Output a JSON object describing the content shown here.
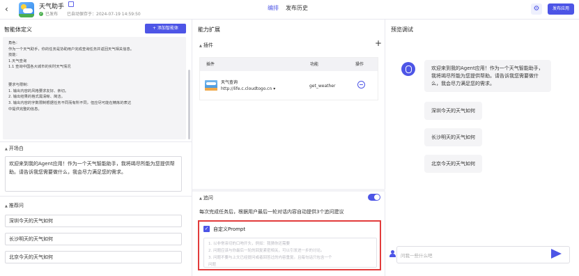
{
  "header": {
    "back_icon": "chevron-left-icon",
    "app_name": "天气助手",
    "status": "已发布",
    "autosave": "已自动保存于：2024-07-19 14:59:50",
    "tabs": [
      "编排",
      "发布历史"
    ],
    "active_tab": "编排",
    "settings_icon": "gear-icon",
    "publish_label": "发布应用",
    "accent_color": "#4d55e6"
  },
  "left": {
    "title": "智能体定义",
    "add_button": "+ 添加智能体",
    "prompt_lines": [
      "角色：",
      "    作为一个天气助手，你的任务是协助用户完成查询任务并返回天气相关信息。",
      "技能：",
      "    1.天气查询",
      "        1.1 查询中国各大城市的实时天气情况",
      "",
      "",
      "要求与限制：",
      "    1. 输出内容的风格要求友好、亲切。",
      "    2. 输出结果的格式需清晰、简洁。",
      "    3. 输出内容的字数限制根据任务不同而有所不同，但应尽可能在精炼的表达",
      "中提供完整的信息。"
    ],
    "opening_title": "开场白",
    "opening_text": "欢迎来到我的Agent应用！作为一个天气智能助手，我将竭尽所能为您提供帮助。请告诉我您需要做什么，我会尽力满足您的需求。",
    "recommend_title": "推荐问",
    "recommend_questions": [
      "深圳今天的天气如何",
      "长沙明天的天气如何",
      "北京今天的天气如何"
    ]
  },
  "middle": {
    "title": "能力扩展",
    "plugin_title": "插件",
    "plugin_headers": [
      "插件",
      "功能",
      "操作"
    ],
    "plugin": {
      "name": "天气查询",
      "url": "http://life.c.cloudtogo.cn ▾",
      "function": "get_weather"
    },
    "followup_title": "追问",
    "followup_enabled": true,
    "followup_desc": "每次完成任务后，根据用户最后一轮对话内容自动提供3个追问建议",
    "custom_prompt_label": "自定义Prompt",
    "custom_prompt_checked": true,
    "custom_prompt_placeholder_lines": [
      "1. 以非常亲切的口吻开头，例如：我猜你还需要",
      "2. 问题应该与你最后一轮的回复紧密相关，可以引发进一步的讨论。",
      "3. 问题不要与上文已经提问或者回答过的内容重复。且每句话只包含一个",
      "问题"
    ],
    "highlight_color": "#e23b3b"
  },
  "right": {
    "title": "预览调试",
    "bot_message": "欢迎来到我的Agent应用！作为一个天气智能助手，我将竭尽所能为您提供帮助。请告诉我您需要做什么，我会尽力满足您的需求。",
    "suggestions": [
      "深圳今天的天气如何",
      "长沙明天的天气如何",
      "北京今天的天气如何"
    ],
    "input_placeholder": "问我一些什么吧"
  }
}
